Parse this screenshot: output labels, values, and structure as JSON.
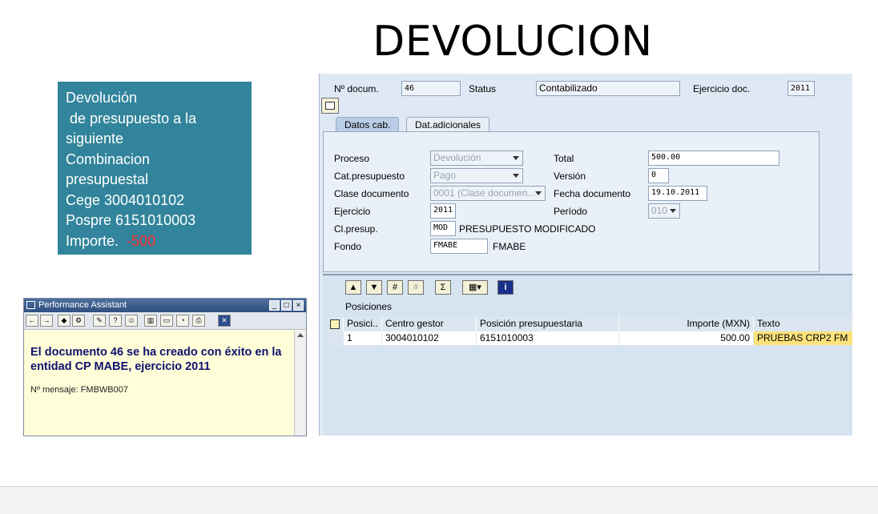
{
  "title": "DEVOLUCION",
  "note": {
    "lines": [
      "Devolución",
      " de presupuesto a la",
      "siguiente",
      "Combinacion",
      "presupuestal",
      "Cege 3004010102",
      "Pospre 6151010003"
    ],
    "importe_label": "Importe.",
    "importe_value": "-500"
  },
  "header": {
    "doc_label": "Nº docum.",
    "doc_value": "46",
    "status_label": "Status",
    "status_value": "Contabilizado",
    "year_label": "Ejercicio doc.",
    "year_value": "2011"
  },
  "tabs": [
    "Datos cab.",
    "Dat.adicionales"
  ],
  "form": {
    "proceso_label": "Proceso",
    "proceso_value": "Devolución",
    "total_label": "Total",
    "total_value": "500.00",
    "catpres_label": "Cat.presupuesto",
    "catpres_value": "Pago",
    "version_label": "Versión",
    "version_value": "0",
    "clase_label": "Clase documento",
    "clase_value": "0001 (Clase documen...",
    "fecha_label": "Fecha documento",
    "fecha_value": "19.10.2011",
    "ejercicio_label": "Ejercicio",
    "ejercicio_value": "2011",
    "periodo_label": "Período",
    "periodo_value": "010",
    "clpres_label": "Cl.presup.",
    "clpres_value": "MOD",
    "clpres_desc": "PRESUPUESTO MODIFICADO",
    "fondo_label": "Fondo",
    "fondo_value": "FMABE",
    "fondo_desc": "FMABE"
  },
  "positions": {
    "section_label": "Posiciones",
    "columns": [
      "Posici..",
      "Centro gestor",
      "Posición presupuestaria",
      "Importe (MXN)",
      "Texto"
    ],
    "rows": [
      [
        "1",
        "3004010102",
        "6151010003",
        "500.00",
        "PRUEBAS CRP2 FM"
      ]
    ]
  },
  "assistant": {
    "title": "Performance Assistant",
    "message": "El documento 46 se ha creado con éxito en la entidad CP MABE, ejercicio 2011",
    "msg_id": "Nº mensaje: FMBWB007"
  },
  "colors": {
    "note_bg": "#31849b",
    "highlight": "#fde27a",
    "negative": "#ff2a2a"
  }
}
